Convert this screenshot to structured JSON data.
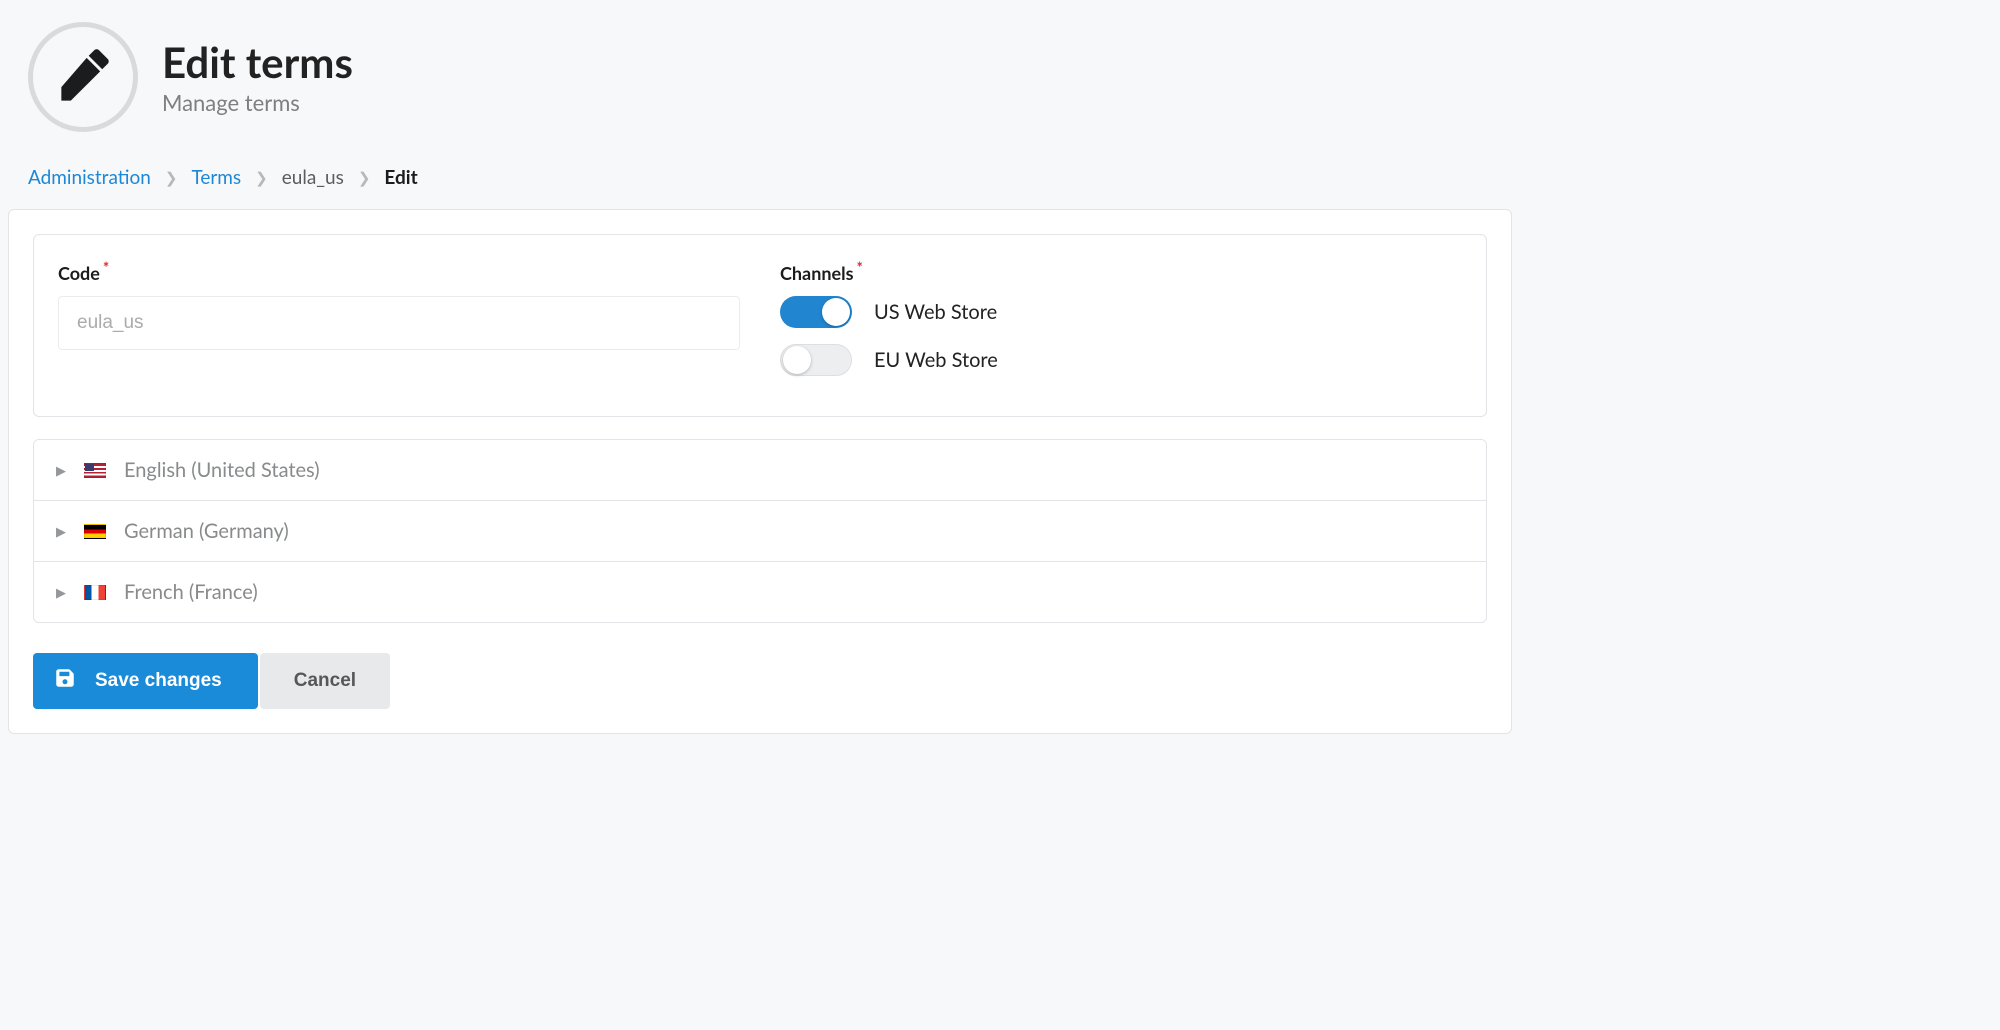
{
  "header": {
    "title": "Edit terms",
    "subtitle": "Manage terms"
  },
  "breadcrumb": {
    "items": [
      {
        "label": "Administration",
        "link": true
      },
      {
        "label": "Terms",
        "link": true
      },
      {
        "label": "eula_us",
        "link": false
      },
      {
        "label": "Edit",
        "link": false,
        "current": true
      }
    ]
  },
  "form": {
    "code": {
      "label": "Code",
      "required": true,
      "value": "eula_us"
    },
    "channels": {
      "label": "Channels",
      "required": true,
      "options": [
        {
          "label": "US Web Store",
          "on": true
        },
        {
          "label": "EU Web Store",
          "on": false
        }
      ]
    }
  },
  "locales": [
    {
      "label": "English (United States)",
      "flag": "us"
    },
    {
      "label": "German (Germany)",
      "flag": "de"
    },
    {
      "label": "French (France)",
      "flag": "fr"
    }
  ],
  "buttons": {
    "save": "Save changes",
    "cancel": "Cancel"
  }
}
